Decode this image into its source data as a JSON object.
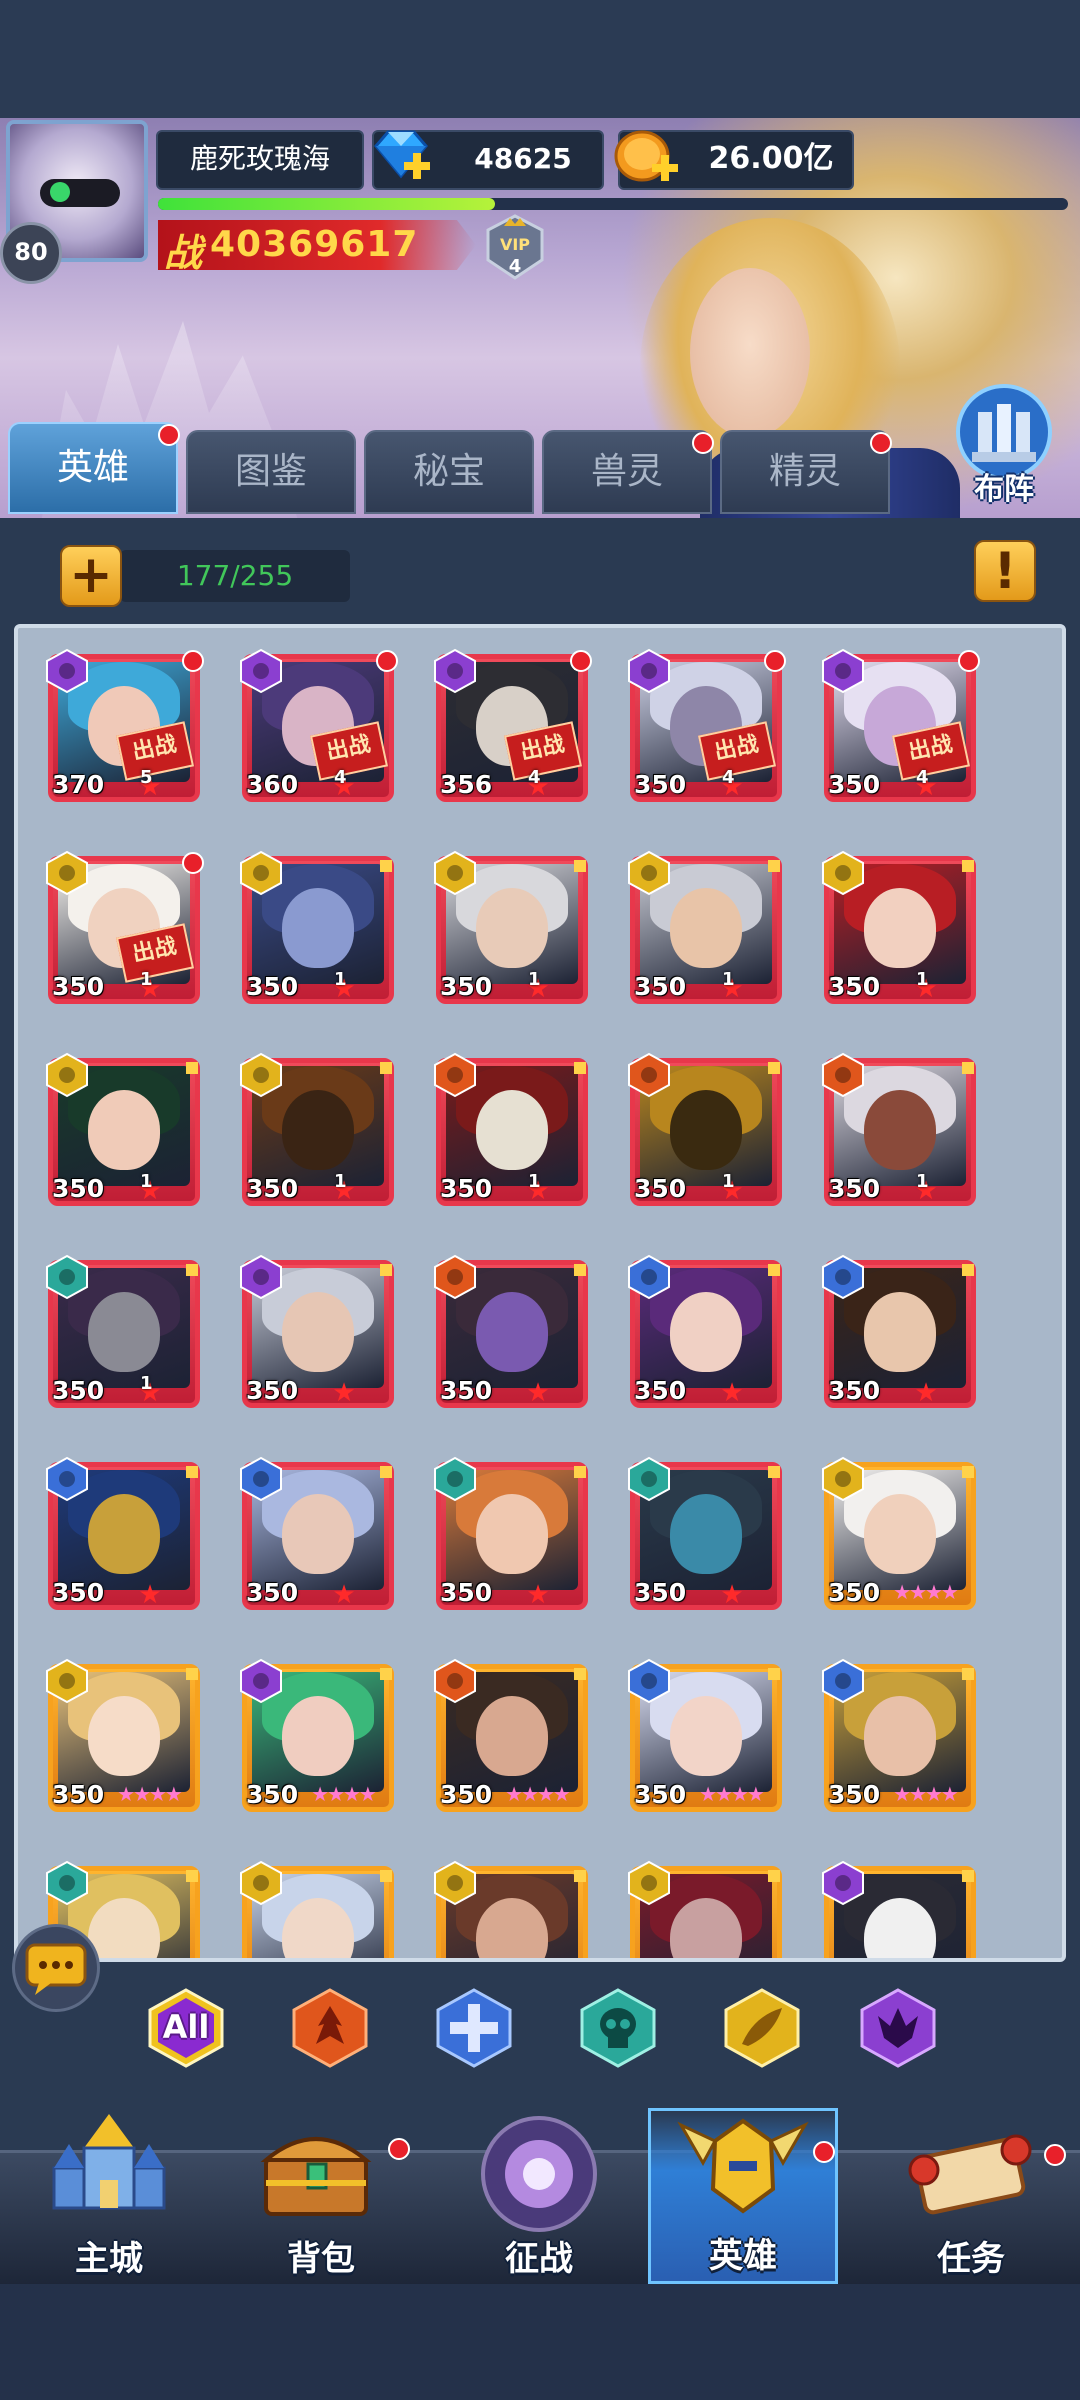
{
  "player": {
    "name": "鹿死玫瑰海",
    "level": "80",
    "diamonds": "48625",
    "gold": "26.00亿",
    "exp_fraction": 0.37,
    "power_prefix": "战",
    "power": "40369617",
    "vip_label": "VIP",
    "vip_level": "4"
  },
  "formation_button": {
    "label": "布阵",
    "icon": "formation-tower-icon"
  },
  "tabs": [
    {
      "label": "英雄",
      "active": true,
      "dot": true
    },
    {
      "label": "图鉴",
      "active": false,
      "dot": false
    },
    {
      "label": "秘宝",
      "active": false,
      "dot": false
    },
    {
      "label": "兽灵",
      "active": false,
      "dot": true
    },
    {
      "label": "精灵",
      "active": false,
      "dot": true
    }
  ],
  "hero_count": "177/255",
  "add_button": {
    "icon": "plus-icon"
  },
  "info_button": {
    "icon": "exclamation-icon"
  },
  "deploy_label": "出战",
  "heroes": [
    {
      "level": "370",
      "stars": "5",
      "star_style": "red",
      "faction": "purple",
      "deployed": true,
      "dot": true,
      "frame": "red",
      "colors": [
        "#3ea9d9",
        "#f0c9b8"
      ]
    },
    {
      "level": "360",
      "stars": "4",
      "star_style": "red",
      "faction": "purple",
      "deployed": true,
      "dot": true,
      "frame": "red",
      "colors": [
        "#4c3a7a",
        "#d9b4c6"
      ]
    },
    {
      "level": "356",
      "stars": "4",
      "star_style": "red",
      "faction": "purple",
      "deployed": true,
      "dot": true,
      "frame": "red",
      "colors": [
        "#2d2d33",
        "#d8d0c8"
      ]
    },
    {
      "level": "350",
      "stars": "4",
      "star_style": "red",
      "faction": "purple",
      "deployed": true,
      "dot": true,
      "frame": "red",
      "colors": [
        "#cfd2e6",
        "#8e86a8"
      ]
    },
    {
      "level": "350",
      "stars": "4",
      "star_style": "red",
      "faction": "purple",
      "deployed": true,
      "dot": true,
      "frame": "red",
      "colors": [
        "#e6e0f2",
        "#c7a8d8"
      ]
    },
    {
      "level": "350",
      "stars": "1",
      "star_style": "red",
      "faction": "gold",
      "deployed": true,
      "dot": true,
      "frame": "red",
      "colors": [
        "#f4f1ec",
        "#f0d2c0"
      ]
    },
    {
      "level": "350",
      "stars": "1",
      "star_style": "red",
      "faction": "gold",
      "deployed": false,
      "dot": false,
      "frame": "red",
      "colors": [
        "#3a4a86",
        "#8a9ad0"
      ]
    },
    {
      "level": "350",
      "stars": "1",
      "star_style": "red",
      "faction": "gold",
      "deployed": false,
      "dot": false,
      "frame": "red",
      "colors": [
        "#d8d8dc",
        "#e8cbb8"
      ]
    },
    {
      "level": "350",
      "stars": "1",
      "star_style": "red",
      "faction": "gold",
      "deployed": false,
      "dot": false,
      "frame": "red",
      "colors": [
        "#c9cbd4",
        "#e8c4a8"
      ]
    },
    {
      "level": "350",
      "stars": "1",
      "star_style": "red",
      "faction": "gold",
      "deployed": false,
      "dot": false,
      "frame": "red",
      "colors": [
        "#b81e24",
        "#f2d0c0"
      ]
    },
    {
      "level": "350",
      "stars": "1",
      "star_style": "red",
      "faction": "gold",
      "deployed": false,
      "dot": false,
      "frame": "red",
      "colors": [
        "#183a2a",
        "#f0cbb8"
      ]
    },
    {
      "level": "350",
      "stars": "1",
      "star_style": "red",
      "faction": "gold",
      "deployed": false,
      "dot": false,
      "frame": "red",
      "colors": [
        "#6a3a18",
        "#3a2414"
      ]
    },
    {
      "level": "350",
      "stars": "1",
      "star_style": "red",
      "faction": "orange",
      "deployed": false,
      "dot": false,
      "frame": "red",
      "colors": [
        "#7a1a1a",
        "#e6e0d2"
      ]
    },
    {
      "level": "350",
      "stars": "1",
      "star_style": "red",
      "faction": "orange",
      "deployed": false,
      "dot": false,
      "frame": "red",
      "colors": [
        "#b8861e",
        "#3a2a10"
      ]
    },
    {
      "level": "350",
      "stars": "1",
      "star_style": "red",
      "faction": "orange",
      "deployed": false,
      "dot": false,
      "frame": "red",
      "colors": [
        "#dcd8e0",
        "#8a4a3a"
      ]
    },
    {
      "level": "350",
      "stars": "1",
      "star_style": "red",
      "faction": "teal",
      "deployed": false,
      "dot": false,
      "frame": "red",
      "colors": [
        "#3a2a4a",
        "#8a8a94"
      ]
    },
    {
      "level": "350",
      "stars": "",
      "star_style": "red",
      "faction": "purple",
      "deployed": false,
      "dot": false,
      "frame": "red",
      "colors": [
        "#c8ccd8",
        "#e6c6b4"
      ]
    },
    {
      "level": "350",
      "stars": "",
      "star_style": "red",
      "faction": "orange",
      "deployed": false,
      "dot": false,
      "frame": "red",
      "colors": [
        "#3a2a3a",
        "#7a5ab0"
      ]
    },
    {
      "level": "350",
      "stars": "",
      "star_style": "red",
      "faction": "blue",
      "deployed": false,
      "dot": false,
      "frame": "red",
      "colors": [
        "#5a2a7a",
        "#f0d0c4"
      ]
    },
    {
      "level": "350",
      "stars": "",
      "star_style": "red",
      "faction": "blue",
      "deployed": false,
      "dot": false,
      "frame": "red",
      "colors": [
        "#3a2418",
        "#e8c6ac"
      ]
    },
    {
      "level": "350",
      "stars": "",
      "star_style": "red",
      "faction": "blue",
      "deployed": false,
      "dot": false,
      "frame": "red",
      "colors": [
        "#1e3a7a",
        "#c8a03a"
      ]
    },
    {
      "level": "350",
      "stars": "",
      "star_style": "red",
      "faction": "blue",
      "deployed": false,
      "dot": false,
      "frame": "red",
      "colors": [
        "#aab8e0",
        "#e8c8b8"
      ]
    },
    {
      "level": "350",
      "stars": "",
      "star_style": "red",
      "faction": "teal",
      "deployed": false,
      "dot": false,
      "frame": "red",
      "colors": [
        "#d87a3a",
        "#f0c8b0"
      ]
    },
    {
      "level": "350",
      "stars": "",
      "star_style": "red",
      "faction": "teal",
      "deployed": false,
      "dot": false,
      "frame": "red",
      "colors": [
        "#2a3a4a",
        "#3a8aa8"
      ]
    },
    {
      "level": "350",
      "stars": "",
      "star_style": "pink",
      "faction": "gold",
      "deployed": false,
      "dot": false,
      "frame": "gold",
      "colors": [
        "#f2f0ee",
        "#f0d0bc"
      ]
    },
    {
      "level": "350",
      "stars": "",
      "star_style": "pink",
      "faction": "gold",
      "deployed": false,
      "dot": false,
      "frame": "gold",
      "colors": [
        "#e8c27a",
        "#f6dcc8"
      ]
    },
    {
      "level": "350",
      "stars": "",
      "star_style": "pink",
      "faction": "purple",
      "deployed": false,
      "dot": false,
      "frame": "gold",
      "colors": [
        "#3ab87a",
        "#f0cdc0"
      ]
    },
    {
      "level": "350",
      "stars": "",
      "star_style": "pink",
      "faction": "orange",
      "deployed": false,
      "dot": false,
      "frame": "gold",
      "colors": [
        "#3a2a22",
        "#d8a890"
      ]
    },
    {
      "level": "350",
      "stars": "",
      "star_style": "pink",
      "faction": "blue",
      "deployed": false,
      "dot": false,
      "frame": "gold",
      "colors": [
        "#d8dcf0",
        "#f2d4c8"
      ]
    },
    {
      "level": "350",
      "stars": "",
      "star_style": "pink",
      "faction": "blue",
      "deployed": false,
      "dot": false,
      "frame": "gold",
      "colors": [
        "#c8a03a",
        "#e8c0a8"
      ]
    },
    {
      "level": "",
      "stars": "",
      "star_style": "none",
      "faction": "teal",
      "deployed": false,
      "dot": false,
      "frame": "gold",
      "colors": [
        "#e0c060",
        "#f2dcc0"
      ]
    },
    {
      "level": "",
      "stars": "",
      "star_style": "none",
      "faction": "gold",
      "deployed": false,
      "dot": false,
      "frame": "gold",
      "colors": [
        "#c8d4ea",
        "#f0d8c8"
      ]
    },
    {
      "level": "",
      "stars": "",
      "star_style": "none",
      "faction": "gold",
      "deployed": false,
      "dot": false,
      "frame": "gold",
      "colors": [
        "#6a3a2a",
        "#d8a890"
      ]
    },
    {
      "level": "",
      "stars": "",
      "star_style": "none",
      "faction": "gold",
      "deployed": false,
      "dot": false,
      "frame": "gold",
      "colors": [
        "#7a1a2a",
        "#c8a0a0"
      ]
    },
    {
      "level": "",
      "stars": "",
      "star_style": "none",
      "faction": "purple",
      "deployed": false,
      "dot": false,
      "frame": "gold",
      "colors": [
        "#2a2a34",
        "#f0f0f0"
      ]
    }
  ],
  "faction_colors": {
    "purple": "#8b3fd0",
    "gold": "#e2b31c",
    "orange": "#e0561c",
    "teal": "#2aa89a",
    "blue": "#3a6fd8"
  },
  "filters": [
    {
      "label": "All",
      "icon": "all-filter-icon",
      "color": "#f0c21e"
    },
    {
      "label": "",
      "icon": "fire-faction-icon",
      "color": "#e0561c"
    },
    {
      "label": "",
      "icon": "cross-faction-icon",
      "color": "#3a6fd8"
    },
    {
      "label": "",
      "icon": "skull-faction-icon",
      "color": "#2aa89a"
    },
    {
      "label": "",
      "icon": "feather-faction-icon",
      "color": "#e2b31c"
    },
    {
      "label": "",
      "icon": "demon-faction-icon",
      "color": "#8b3fd0"
    }
  ],
  "chat_button": {
    "icon": "chat-bubble-icon"
  },
  "nav": [
    {
      "label": "主城",
      "icon": "castle-icon",
      "active": false,
      "dot": false
    },
    {
      "label": "背包",
      "icon": "chest-icon",
      "active": false,
      "dot": true
    },
    {
      "label": "征战",
      "icon": "dragon-portal-icon",
      "active": false,
      "dot": false
    },
    {
      "label": "英雄",
      "icon": "hero-helmet-icon",
      "active": true,
      "dot": true
    },
    {
      "label": "任务",
      "icon": "scroll-icon",
      "active": false,
      "dot": true
    }
  ]
}
